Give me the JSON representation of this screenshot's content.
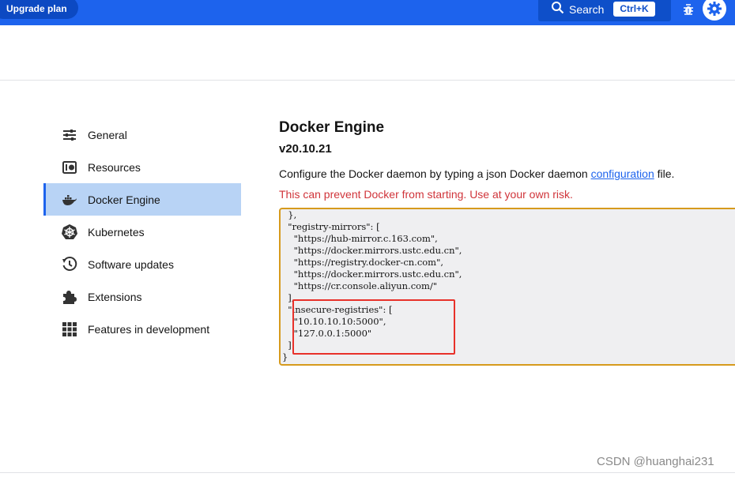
{
  "topbar": {
    "upgrade_label": "Upgrade plan",
    "search_label": "Search",
    "search_shortcut": "Ctrl+K",
    "accent": "#1d63ed"
  },
  "sidebar": {
    "items": [
      {
        "label": "General",
        "icon": "sliders-icon",
        "active": false
      },
      {
        "label": "Resources",
        "icon": "resources-icon",
        "active": false
      },
      {
        "label": "Docker Engine",
        "icon": "docker-whale-icon",
        "active": true
      },
      {
        "label": "Kubernetes",
        "icon": "kubernetes-icon",
        "active": false
      },
      {
        "label": "Software updates",
        "icon": "history-icon",
        "active": false
      },
      {
        "label": "Extensions",
        "icon": "puzzle-icon",
        "active": false
      },
      {
        "label": "Features in development",
        "icon": "grid-icon",
        "active": false
      }
    ]
  },
  "main": {
    "title": "Docker Engine",
    "version": "v20.10.21",
    "desc_prefix": "Configure the Docker daemon by typing a json Docker daemon ",
    "desc_link": "configuration",
    "desc_suffix": " file.",
    "warning": "This can prevent Docker from starting. Use at your own risk."
  },
  "editor": {
    "lines": [
      "  },",
      "  \"registry-mirrors\": [",
      "    \"https://hub-mirror.c.163.com\",",
      "    \"https://docker.mirrors.ustc.edu.cn\",",
      "    \"https://registry.docker-cn.com\",",
      "    \"https://docker.mirrors.ustc.edu.cn\",",
      "    \"https://cr.console.aliyun.com/\"",
      "  ],",
      "  \"insecure-registries\": [",
      "    \"10.10.10.10:5000\",",
      "    \"127.0.0.1:5000\"",
      "  ]",
      "}"
    ]
  },
  "watermark": "CSDN @huanghai231"
}
